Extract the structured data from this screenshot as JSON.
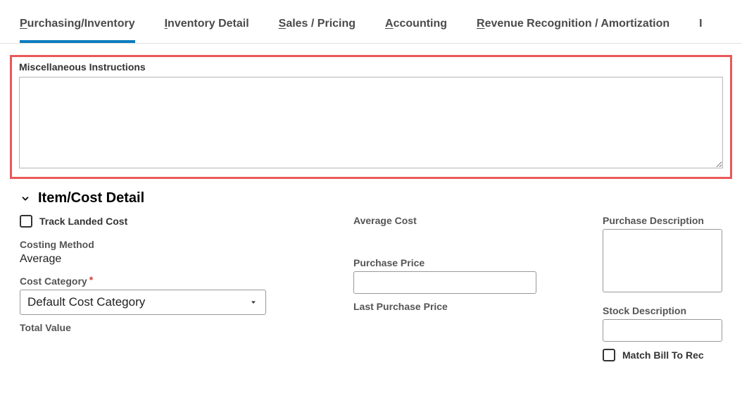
{
  "tabs": {
    "purchasing": {
      "accel": "P",
      "rest": "urchasing/Inventory"
    },
    "inventory_detail": {
      "accel": "I",
      "rest": "nventory Detail"
    },
    "sales_pricing": {
      "accel": "S",
      "rest": "ales / Pricing"
    },
    "accounting": {
      "accel": "A",
      "rest": "ccounting"
    },
    "revenue": {
      "accel": "R",
      "rest": "evenue Recognition / Amortization"
    }
  },
  "misc": {
    "label": "Miscellaneous Instructions",
    "value": ""
  },
  "section": {
    "title": "Item/Cost Detail"
  },
  "col1": {
    "track_landed_label": "Track Landed Cost",
    "costing_method_label": "Costing Method",
    "costing_method_value": "Average",
    "cost_category_label": "Cost Category",
    "cost_category_value": "Default Cost Category",
    "total_value_label": "Total Value"
  },
  "col2": {
    "average_cost_label": "Average Cost",
    "purchase_price_label": "Purchase Price",
    "purchase_price_value": "",
    "last_purchase_price_label": "Last Purchase Price"
  },
  "col3": {
    "purchase_desc_label": "Purchase Description",
    "purchase_desc_value": "",
    "stock_desc_label": "Stock Description",
    "stock_desc_value": "",
    "match_bill_label": "Match Bill To Rec"
  }
}
